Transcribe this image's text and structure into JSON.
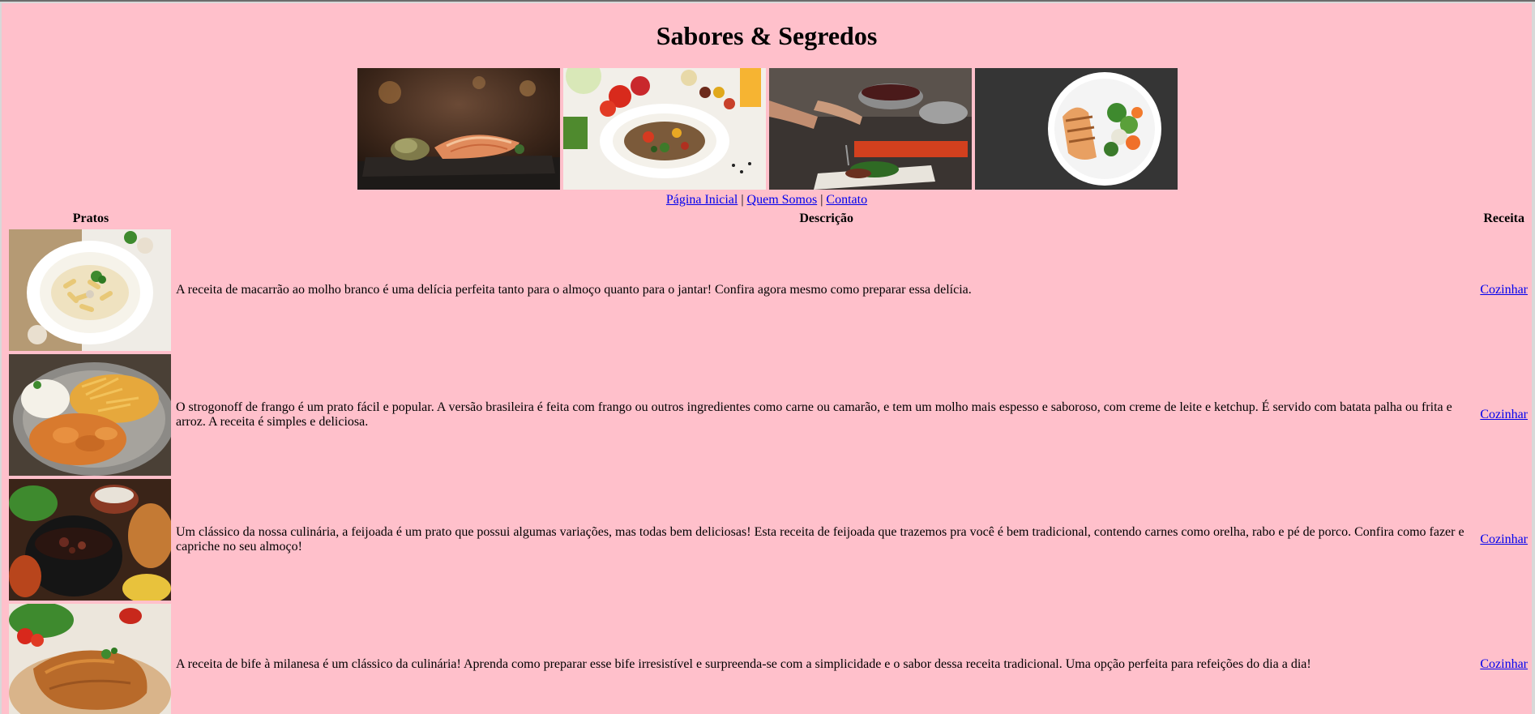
{
  "site": {
    "title": "Sabores & Segredos"
  },
  "banner": {
    "images": [
      {
        "name": "grilled-salmon-photo"
      },
      {
        "name": "vegetable-salad-photo"
      },
      {
        "name": "chef-plating-photo"
      },
      {
        "name": "grilled-chicken-photo"
      }
    ]
  },
  "nav": {
    "items": [
      {
        "label": "Página Inicial"
      },
      {
        "label": "Quem Somos"
      },
      {
        "label": "Contato"
      }
    ],
    "separator": "|"
  },
  "table": {
    "headers": {
      "dishes": "Pratos",
      "description": "Descrição",
      "recipe": "Receita"
    },
    "rows": [
      {
        "image": "white-sauce-pasta-photo",
        "description": "A receita de macarrão ao molho branco é uma delícia perfeita tanto para o almoço quanto para o jantar! Confira agora mesmo como preparar essa delícia.",
        "link": "Cozinhar"
      },
      {
        "image": "chicken-strogonoff-photo",
        "description": "O strogonoff de frango é um prato fácil e popular. A versão brasileira é feita com frango ou outros ingredientes como carne ou camarão, e tem um molho mais espesso e saboroso, com creme de leite e ketchup. É servido com batata palha ou frita e arroz. A receita é simples e deliciosa.",
        "link": "Cozinhar"
      },
      {
        "image": "feijoada-photo",
        "description": "Um clássico da nossa culinária, a feijoada é um prato que possui algumas variações, mas todas bem deliciosas! Esta receita de feijoada que trazemos pra você é bem tradicional, contendo carnes como orelha, rabo e pé de porco. Confira como fazer e capriche no seu almoço!",
        "link": "Cozinhar"
      },
      {
        "image": "bife-milanesa-photo",
        "description": "A receita de bife à milanesa é um clássico da culinária! Aprenda como preparar esse bife irresistível e surpreenda-se com a simplicidade e o sabor dessa receita tradicional. Uma opção perfeita para refeições do dia a dia!",
        "link": "Cozinhar"
      }
    ]
  },
  "colors": {
    "page_background": "#ffc0cb",
    "link": "#0000ee"
  }
}
